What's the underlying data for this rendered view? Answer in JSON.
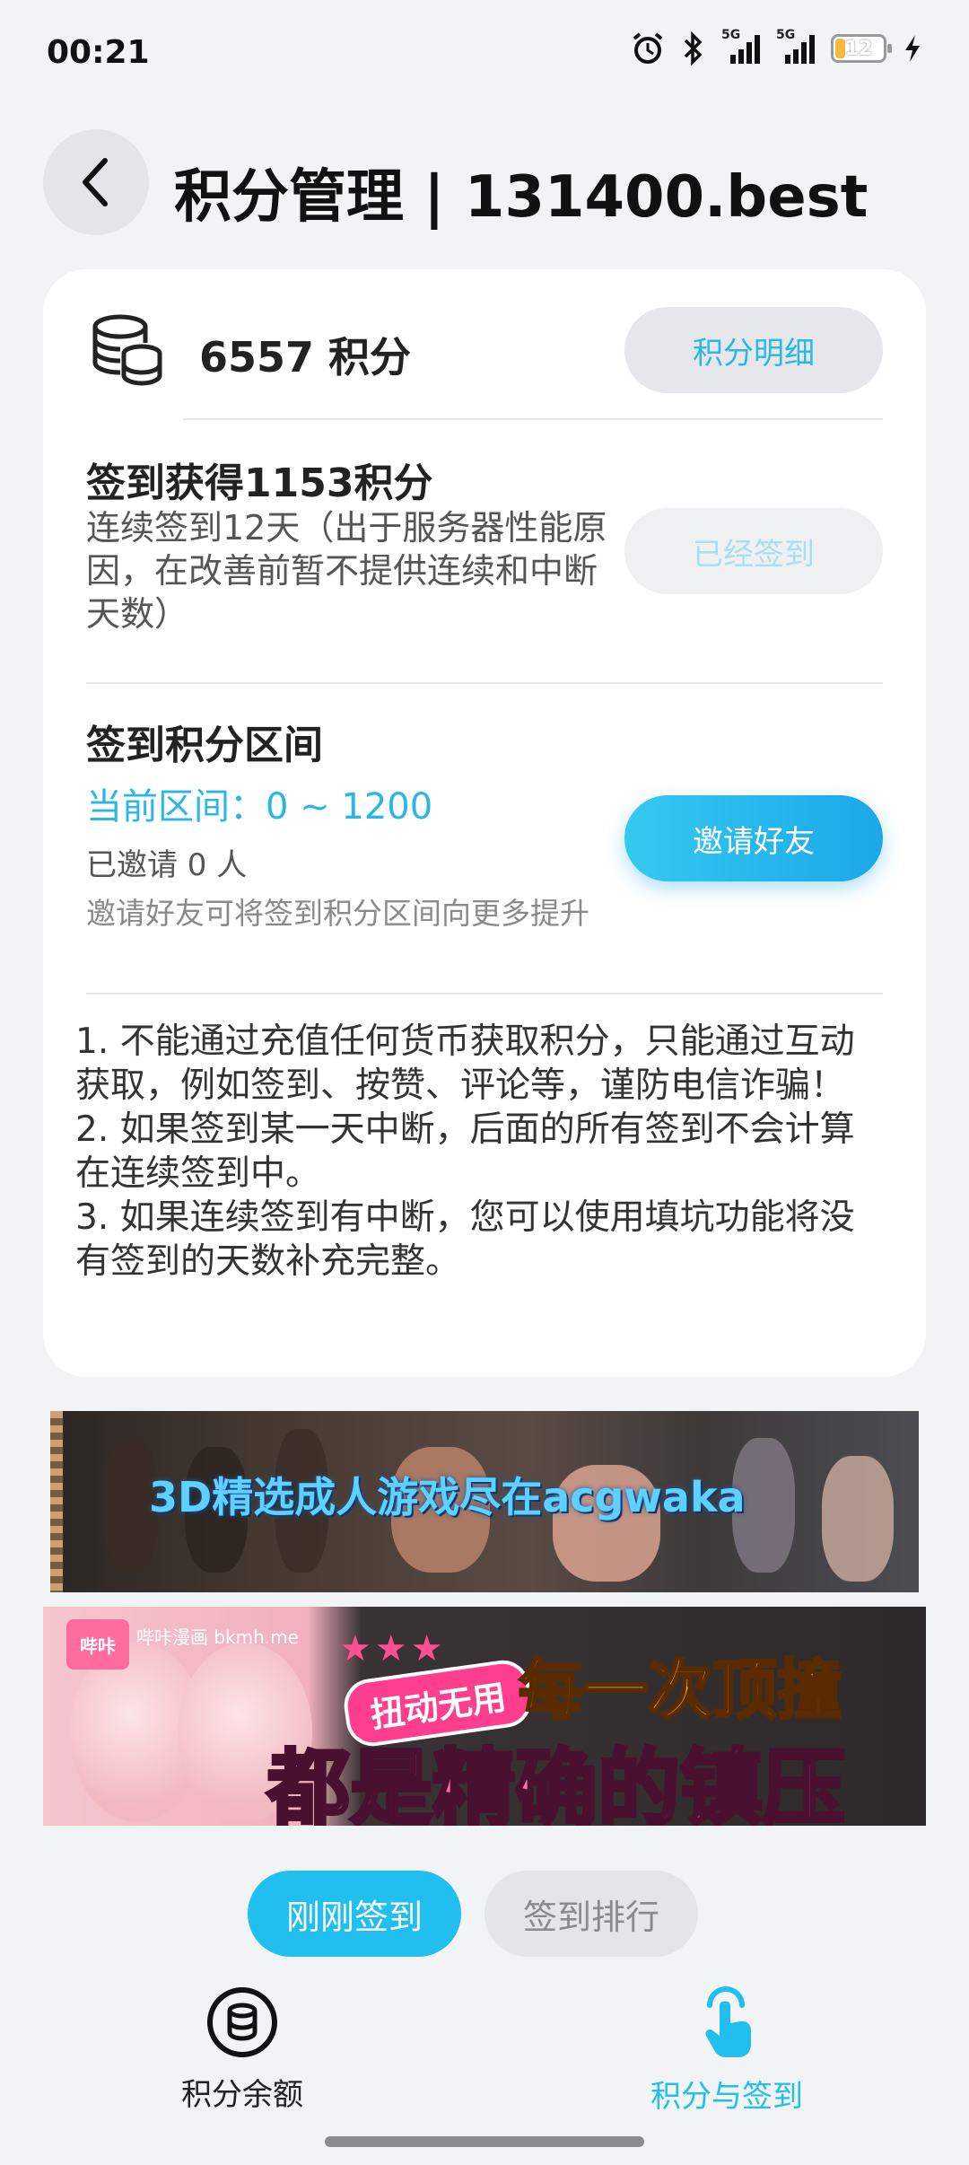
{
  "status_bar": {
    "time": "00:21",
    "network_1": "5G",
    "network_2": "5G",
    "battery": "12"
  },
  "header": {
    "back_icon": "chevron-left-icon",
    "title": "积分管理 | 131400.best"
  },
  "points": {
    "icon": "coin-stack-icon",
    "balance_text": "6557 积分",
    "detail_button": "积分明细"
  },
  "checkin": {
    "title": "签到获得1153积分",
    "desc": "连续签到12天（出于服务器性能原因，在改善前暂不提供连续和中断天数）",
    "button": "已经签到"
  },
  "range": {
    "title": "签到积分区间",
    "current": "当前区间：0 ~ 1200",
    "invited": "已邀请 0 人",
    "hint": "邀请好友可将签到积分区间向更多提升",
    "invite_button": "邀请好友"
  },
  "rules": [
    "1. 不能通过充值任何货币获取积分，只能通过互动获取，例如签到、按赞、评论等，谨防电信诈骗！",
    "2. 如果签到某一天中断，后面的所有签到不会计算在连续签到中。",
    "3. 如果连续签到有中断，您可以使用填坑功能将没有签到的天数补充完整。"
  ],
  "banners": {
    "banner1_text": "3D精选成人游戏尽在acgwaka",
    "banner2_tag": "扭动无用",
    "banner2_line1": "每一次顶撞",
    "banner2_line2": "都是精确的镇压",
    "banner2_logo": "哔咔",
    "banner2_site": "哔咔漫画 bkmh.me"
  },
  "tabs": {
    "active": "刚刚签到",
    "inactive": "签到排行"
  },
  "bottom_nav": [
    {
      "label": "积分余额",
      "icon": "coin-stack-icon",
      "color": "#222222"
    },
    {
      "label": "积分与签到",
      "icon": "tap-hand-icon",
      "color": "#21bff0"
    }
  ],
  "colors": {
    "accent": "#21bff0",
    "background": "#f1f3f5"
  }
}
